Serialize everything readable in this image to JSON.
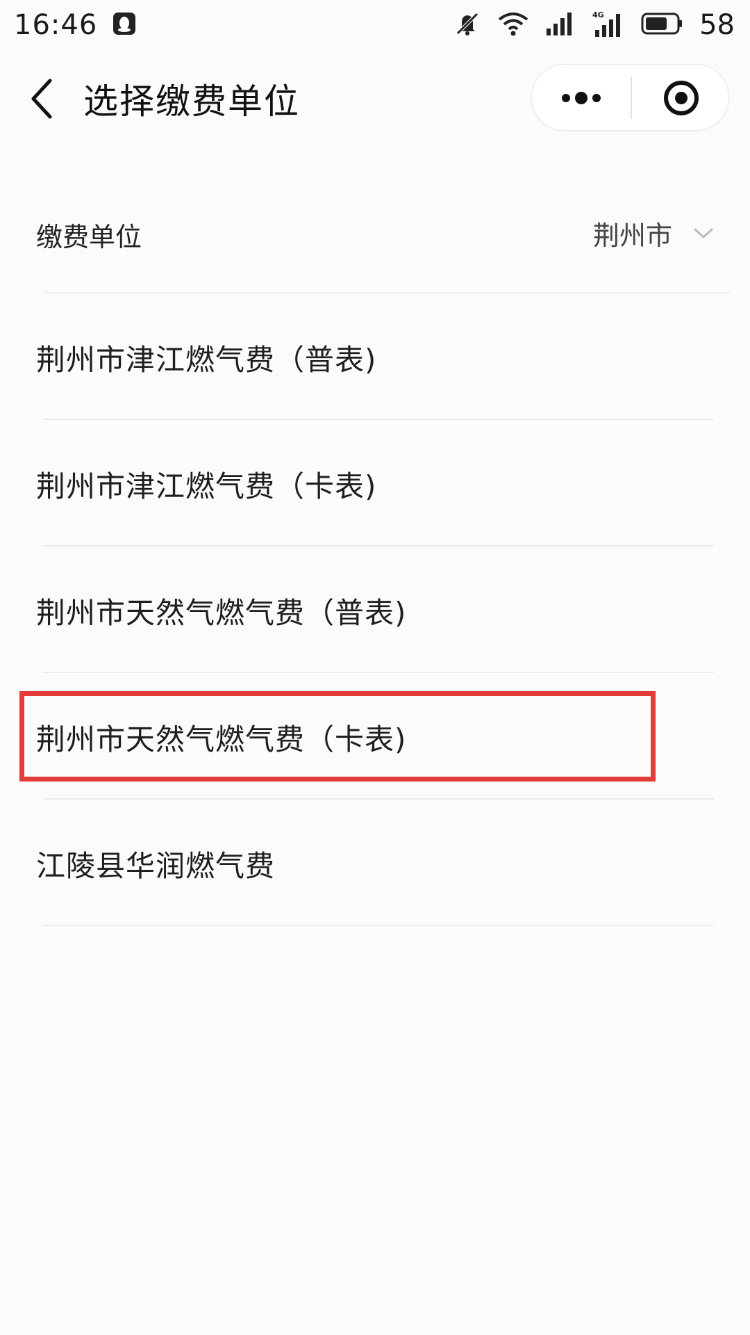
{
  "status_bar": {
    "time": "16:46",
    "battery": "58",
    "icons": [
      "qq-icon",
      "mute-icon",
      "wifi-icon",
      "signal-icon",
      "signal-4g-icon",
      "battery-icon"
    ]
  },
  "nav": {
    "title": "选择缴费单位",
    "back_icon": "back-arrow-icon",
    "more_icon": "more-dots-icon",
    "close_icon": "target-close-icon"
  },
  "filter": {
    "label": "缴费单位",
    "value": "荆州市"
  },
  "items": [
    {
      "label": "荆州市津江燃气费（普表)"
    },
    {
      "label": "荆州市津江燃气费（卡表)"
    },
    {
      "label": "荆州市天然气燃气费（普表)"
    },
    {
      "label": "荆州市天然气燃气费（卡表)"
    },
    {
      "label": "江陵县华润燃气费"
    }
  ],
  "colors": {
    "highlight": "#e33a3a",
    "background": "#fbfbfb"
  }
}
